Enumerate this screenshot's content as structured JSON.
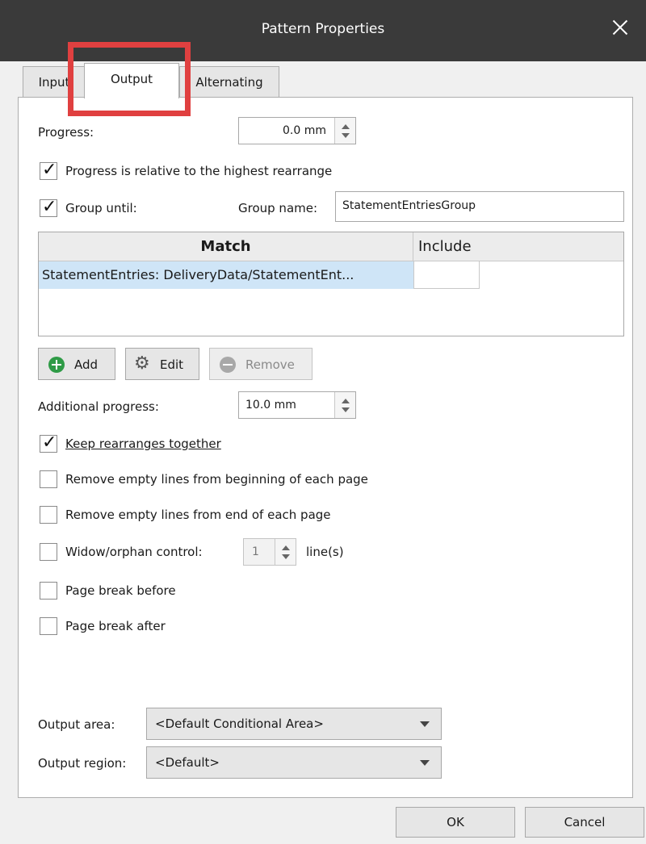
{
  "window": {
    "title": "Pattern Properties"
  },
  "tabs": [
    {
      "label": "Input"
    },
    {
      "label": "Output"
    },
    {
      "label": "Alternating"
    }
  ],
  "progress": {
    "label": "Progress:",
    "value": "0.0 mm"
  },
  "relative": {
    "label": "Progress is relative to the highest rearrange",
    "checked": true
  },
  "group": {
    "label": "Group until:",
    "checked": true,
    "name_label": "Group name:",
    "name_value": "StatementEntriesGroup"
  },
  "table": {
    "columns": [
      "Match",
      "Include"
    ],
    "rows": [
      {
        "match": "StatementEntries: DeliveryData/StatementEnt...",
        "include": ""
      }
    ]
  },
  "buttons": {
    "add": "Add",
    "edit": "Edit",
    "remove": "Remove"
  },
  "additional_progress": {
    "label": "Additional progress:",
    "value": "10.0 mm"
  },
  "options": {
    "keep_rearranges": {
      "label": "Keep rearranges together",
      "checked": true
    },
    "remove_empty_begin": {
      "label": "Remove empty lines from beginning of each page",
      "checked": false
    },
    "remove_empty_end": {
      "label": "Remove empty lines from end of each page",
      "checked": false
    },
    "widow_orphan": {
      "label": "Widow/orphan control:",
      "checked": false,
      "value": "1",
      "unit": "line(s)"
    },
    "page_break_before": {
      "label": "Page break before",
      "checked": false
    },
    "page_break_after": {
      "label": "Page break after",
      "checked": false
    }
  },
  "output_area": {
    "label": "Output area:",
    "value": "<Default Conditional Area>"
  },
  "output_region": {
    "label": "Output region:",
    "value": "<Default>"
  },
  "footer": {
    "ok": "OK",
    "cancel": "Cancel"
  },
  "colors": {
    "titlebar": "#3a3a3a",
    "highlight": "#e04040",
    "selection": "#cfe5f7",
    "add_icon": "#2e9b46"
  },
  "icons": {
    "close": "close-icon",
    "add": "plus-circle-icon",
    "edit": "gear-icon",
    "remove": "minus-circle-icon"
  }
}
